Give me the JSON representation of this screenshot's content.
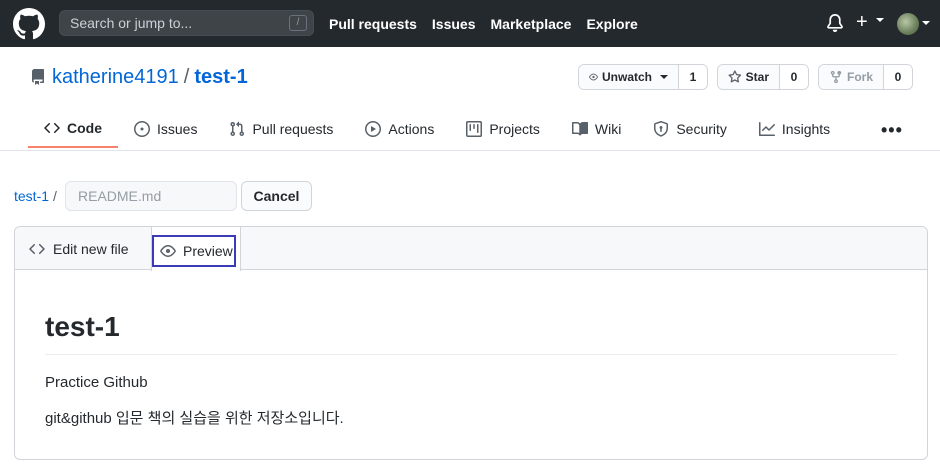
{
  "header": {
    "search_placeholder": "Search or jump to...",
    "search_shortcut": "/",
    "nav": [
      "Pull requests",
      "Issues",
      "Marketplace",
      "Explore"
    ],
    "plus_label": "+"
  },
  "repo": {
    "owner": "katherine4191",
    "separator": "/",
    "name": "test-1",
    "watch_label": "Unwatch",
    "watch_count": "1",
    "star_label": "Star",
    "star_count": "0",
    "fork_label": "Fork",
    "fork_count": "0"
  },
  "tabs": [
    {
      "label": "Code",
      "icon": "code-icon",
      "active": true
    },
    {
      "label": "Issues",
      "icon": "issue-icon"
    },
    {
      "label": "Pull requests",
      "icon": "pull-request-icon"
    },
    {
      "label": "Actions",
      "icon": "play-icon"
    },
    {
      "label": "Projects",
      "icon": "project-icon"
    },
    {
      "label": "Wiki",
      "icon": "book-icon"
    },
    {
      "label": "Security",
      "icon": "shield-icon"
    },
    {
      "label": "Insights",
      "icon": "graph-icon"
    }
  ],
  "more_label": "•••",
  "editor": {
    "breadcrumb_repo": "test-1",
    "breadcrumb_sep": "/",
    "filename_placeholder": "README.md",
    "cancel_label": "Cancel",
    "tab_edit_label": "Edit new file",
    "tab_preview_label": "Preview"
  },
  "preview": {
    "heading": "test-1",
    "paragraph1": "Practice Github",
    "paragraph2": "git&github 입문 책의 실습을 위한 저장소입니다."
  },
  "colors": {
    "header_bg": "#24292e",
    "link": "#0366d6",
    "active_tab_underline": "#f9826c",
    "preview_highlight": "#3b3bb5"
  }
}
